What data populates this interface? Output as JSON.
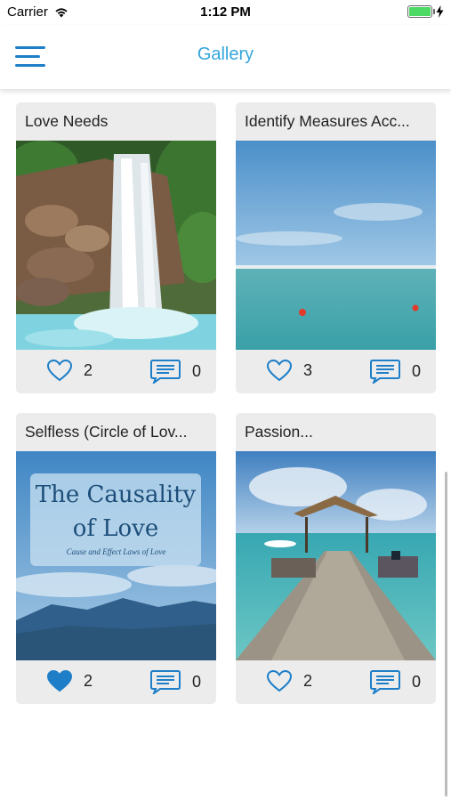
{
  "status_bar": {
    "carrier": "Carrier",
    "time": "1:12 PM",
    "wifi_icon": "wifi-icon",
    "battery_icon": "battery-icon",
    "charging_icon": "bolt-icon"
  },
  "nav": {
    "title": "Gallery",
    "menu_icon": "hamburger-menu-icon"
  },
  "colors": {
    "accent": "#35a5dd",
    "icon_blue": "#1e7fc8",
    "card_bg": "#ececec",
    "battery_green": "#4cd964"
  },
  "gallery": [
    {
      "title": "Love Needs",
      "likes": "2",
      "comments": "0",
      "liked": false,
      "image": "waterfall-photo"
    },
    {
      "title": "Identify Measures Acc...",
      "likes": "3",
      "comments": "0",
      "liked": false,
      "image": "ocean-photo"
    },
    {
      "title": "Selfless (Circle of Lov...",
      "likes": "2",
      "comments": "0",
      "liked": true,
      "image": "book-cover-photo",
      "image_text": {
        "title": "The Causality of Love",
        "subtitle": "Cause and Effect Laws of Love"
      }
    },
    {
      "title": "Passion...",
      "likes": "2",
      "comments": "0",
      "liked": false,
      "image": "pier-photo"
    }
  ]
}
